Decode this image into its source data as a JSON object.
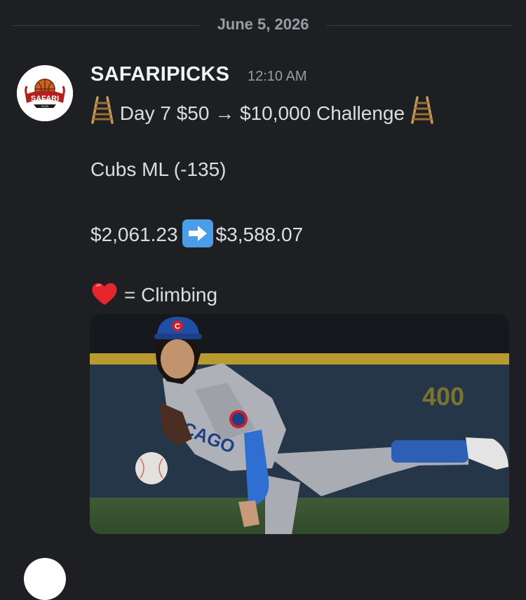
{
  "date_divider": {
    "label": "June 5, 2026"
  },
  "message": {
    "author": "SAFARIPICKS",
    "timestamp": "12:10 AM",
    "avatar_text": "SAFARI",
    "avatar_subtext": "PICKS",
    "lines": {
      "title": "Day 7 $50 → $10,000 Challenge",
      "pick": "Cubs ML (-135)",
      "bankroll_from": "$2,061.23",
      "bankroll_to": "$3,588.07",
      "reaction_text": "= Climbing"
    },
    "icons": {
      "title_left": "ladder-icon",
      "title_right": "ladder-icon",
      "bankroll_arrow": "right-arrow-icon",
      "reaction": "red-heart-icon"
    },
    "attachment": {
      "type": "photo",
      "cap_logo": "C",
      "jersey_text": "CAGO",
      "wall_number": "400"
    }
  },
  "colors": {
    "background": "#1e1f23",
    "username": "#f2f3f5",
    "muted": "#9b9ca3",
    "arrow_box": "#4a9de8",
    "heart": "#e5262c"
  }
}
